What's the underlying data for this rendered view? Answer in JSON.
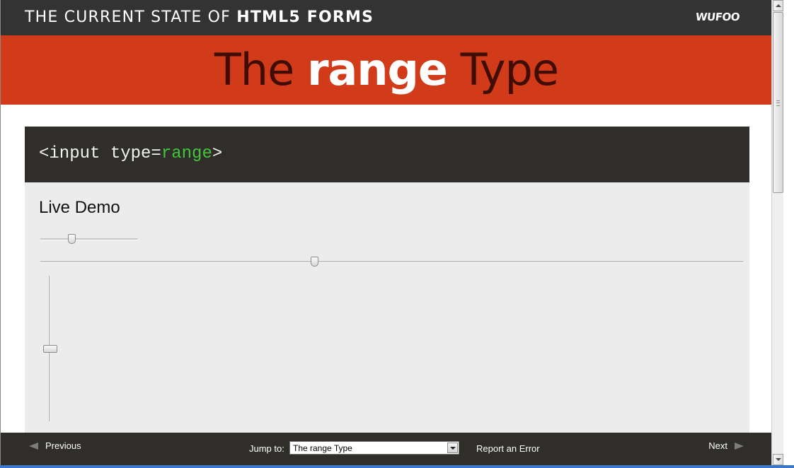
{
  "header": {
    "site_title_prefix": "THE CURRENT STATE OF ",
    "site_title_strong": "HTML5 FORMS",
    "logo_text": "WUFOO"
  },
  "hero": {
    "title_prefix": "The ",
    "title_strong": "range",
    "title_suffix": " Type"
  },
  "code": {
    "prefix": "<input type=",
    "value": "range",
    "suffix": ">"
  },
  "demo": {
    "title": "Live Demo",
    "sliders": [
      {
        "orientation": "horizontal",
        "value_fraction": 0.32
      },
      {
        "orientation": "horizontal",
        "value_fraction": 0.39
      },
      {
        "orientation": "vertical",
        "value_fraction": 0.5
      }
    ]
  },
  "footer": {
    "previous_label": "Previous",
    "next_label": "Next",
    "jump_label": "Jump to:",
    "jump_selected": "The range Type",
    "report_label": "Report an Error"
  },
  "colors": {
    "topbar": "#333333",
    "hero": "#d13b1a",
    "hero_text": "#3f0d04",
    "code_bg": "#2f2e2a",
    "code_value": "#44c43c",
    "demo_bg": "#ececec"
  }
}
